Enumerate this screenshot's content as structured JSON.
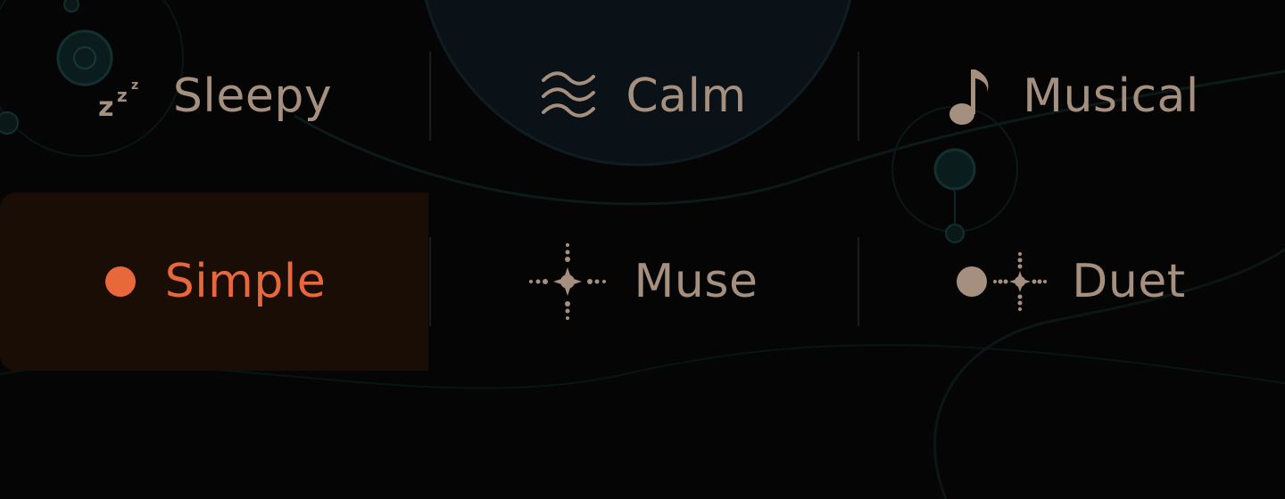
{
  "colors": {
    "background": "#050505",
    "label": "#a58f7e",
    "accent": "#e8683c",
    "selected_bg": "#1a0d06",
    "decor": "#0f2826"
  },
  "modes": [
    {
      "label": "Sleepy",
      "icon": "zzz-icon",
      "selected": false
    },
    {
      "label": "Calm",
      "icon": "waves-icon",
      "selected": false
    },
    {
      "label": "Musical",
      "icon": "music-note-icon",
      "selected": false
    },
    {
      "label": "Simple",
      "icon": "dot-icon",
      "selected": true
    },
    {
      "label": "Muse",
      "icon": "sparkle-icon",
      "selected": false
    },
    {
      "label": "Duet",
      "icon": "dot-sparkle-icon",
      "selected": false
    }
  ]
}
